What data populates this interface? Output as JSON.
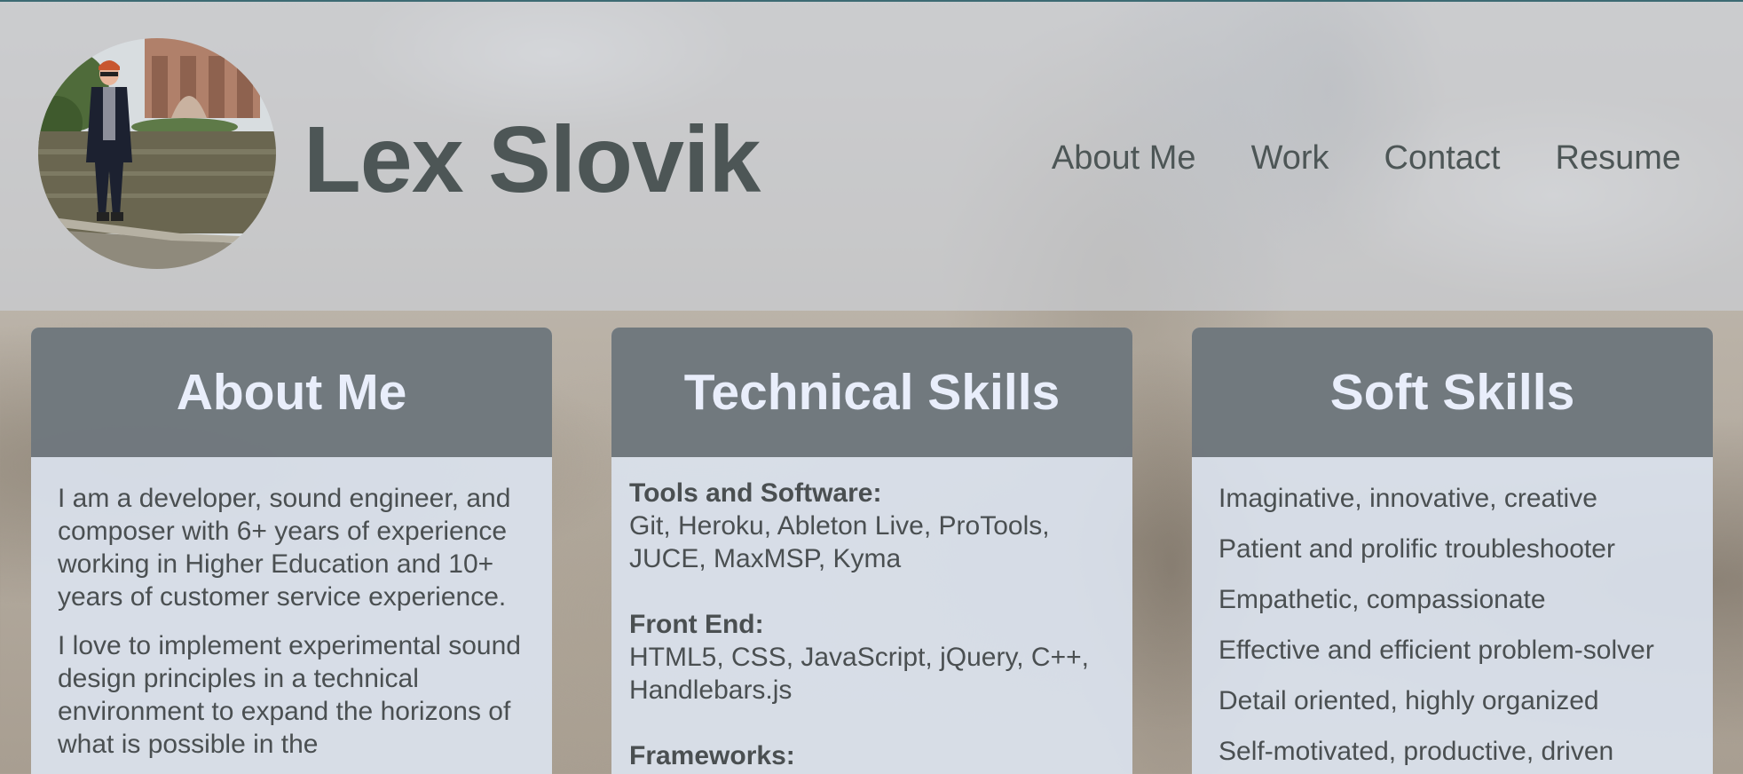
{
  "header": {
    "name": "Lex Slovik",
    "avatar_icon": "profile-photo",
    "nav": [
      {
        "label": "About Me"
      },
      {
        "label": "Work"
      },
      {
        "label": "Contact"
      },
      {
        "label": "Resume"
      }
    ]
  },
  "about": {
    "title": "About Me",
    "paragraphs": [
      "I am a developer, sound engineer, and composer with 6+ years of experience working in Higher Education and 10+ years of customer service experience.",
      "I love to implement experimental sound design principles in a technical environment to expand the horizons of what is possible in the"
    ]
  },
  "technical": {
    "title": "Technical Skills",
    "groups": [
      {
        "label": "Tools and Software:",
        "value": "Git, Heroku, Ableton Live, ProTools, JUCE, MaxMSP, Kyma"
      },
      {
        "label": "Front End:",
        "value": "HTML5, CSS, JavaScript, jQuery, C++, Handlebars.js"
      },
      {
        "label": "Frameworks:",
        "value": ""
      }
    ]
  },
  "soft": {
    "title": "Soft Skills",
    "items": [
      "Imaginative, innovative, creative",
      "Patient and prolific troubleshooter",
      "Empathetic, compassionate",
      "Effective and efficient problem-solver",
      "Detail oriented, highly organized",
      "Self-motivated, productive, driven"
    ]
  },
  "colors": {
    "header_text": "#4d5656",
    "card_header_bg": "#6c7378",
    "card_header_text": "#e9eefb",
    "card_body_bg": "#dce3f0"
  }
}
